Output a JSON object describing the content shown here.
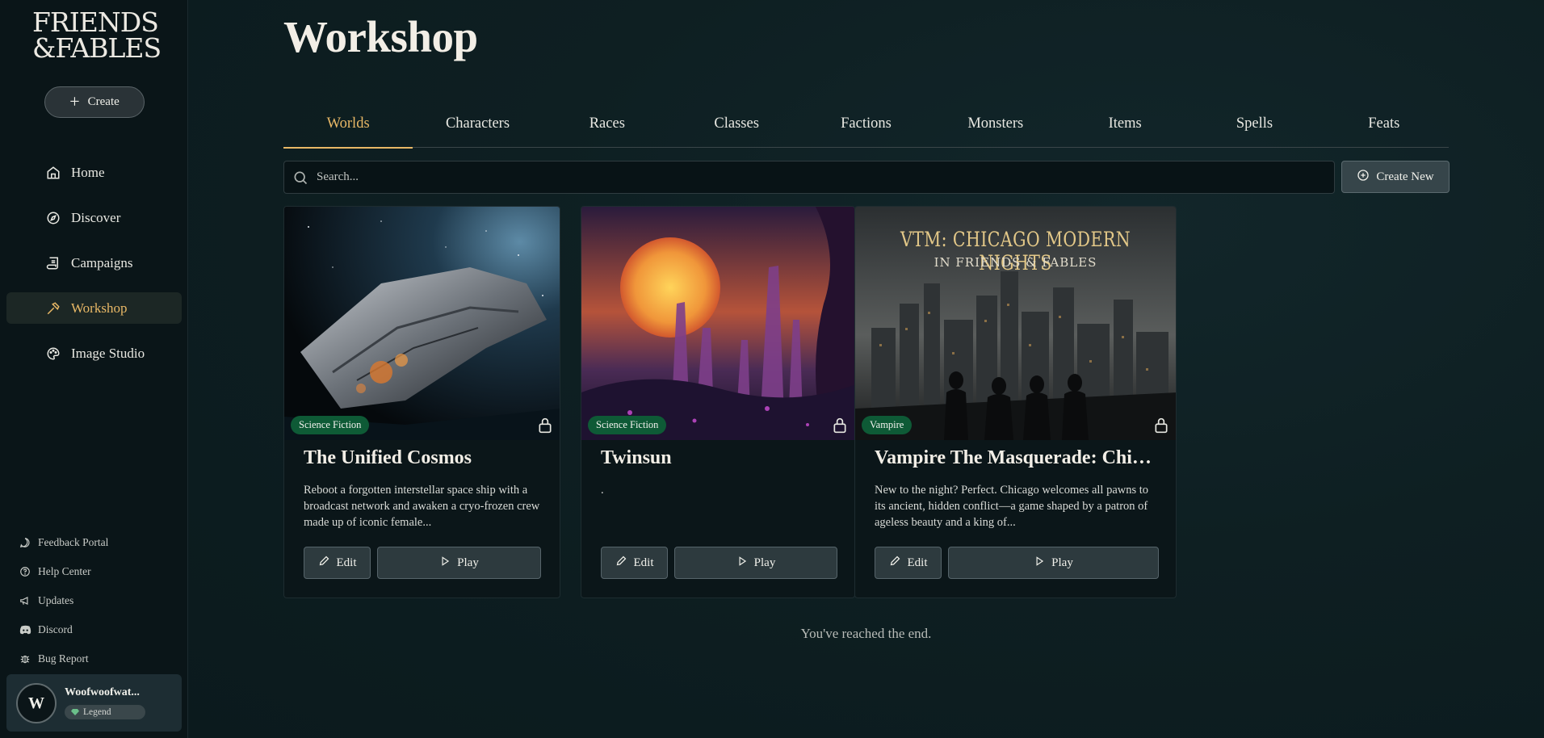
{
  "app": {
    "logo_line1": "FRIENDS",
    "logo_line2": "&FABLES"
  },
  "sidebar": {
    "create_label": "Create",
    "nav": [
      {
        "label": "Home",
        "icon": "home-icon"
      },
      {
        "label": "Discover",
        "icon": "compass-icon"
      },
      {
        "label": "Campaigns",
        "icon": "scroll-icon"
      },
      {
        "label": "Workshop",
        "icon": "hammer-icon",
        "active": true
      },
      {
        "label": "Image Studio",
        "icon": "palette-icon"
      }
    ],
    "footer": [
      {
        "label": "Feedback Portal",
        "icon": "message-icon"
      },
      {
        "label": "Help Center",
        "icon": "help-icon"
      },
      {
        "label": "Updates",
        "icon": "megaphone-icon"
      },
      {
        "label": "Discord",
        "icon": "discord-icon"
      },
      {
        "label": "Bug Report",
        "icon": "bug-icon"
      }
    ],
    "user": {
      "initial": "W",
      "name": "Woofwoofwat...",
      "tier": "Legend"
    }
  },
  "main": {
    "title": "Workshop",
    "tabs": [
      "Worlds",
      "Characters",
      "Races",
      "Classes",
      "Factions",
      "Monsters",
      "Items",
      "Spells",
      "Feats"
    ],
    "active_tab": "Worlds",
    "search_placeholder": "Search...",
    "create_new_label": "Create New",
    "cards": [
      {
        "genre": "Science Fiction",
        "title": "The Unified Cosmos",
        "description": "Reboot a forgotten interstellar space ship with a broadcast network and awaken a cryo-frozen crew made up of iconic female...",
        "edit_label": "Edit",
        "play_label": "Play"
      },
      {
        "genre": "Science Fiction",
        "title": "Twinsun",
        "description": ".",
        "edit_label": "Edit",
        "play_label": "Play"
      },
      {
        "genre": "Vampire",
        "title": "Vampire The Masquerade: Chica...",
        "description": "New to the night? Perfect. Chicago welcomes all pawns to its ancient, hidden conflict—a game shaped by a patron of ageless beauty and a king of...",
        "edit_label": "Edit",
        "play_label": "Play",
        "image_title": "VTM: CHICAGO MODERN NIGHTS",
        "image_subtitle": "IN FRIENDS & FABLES"
      }
    ],
    "end_message": "You've reached the end."
  },
  "colors": {
    "accent": "#e8b866",
    "genre_badge": "#0e5a36",
    "background": "#0c1a1e"
  }
}
